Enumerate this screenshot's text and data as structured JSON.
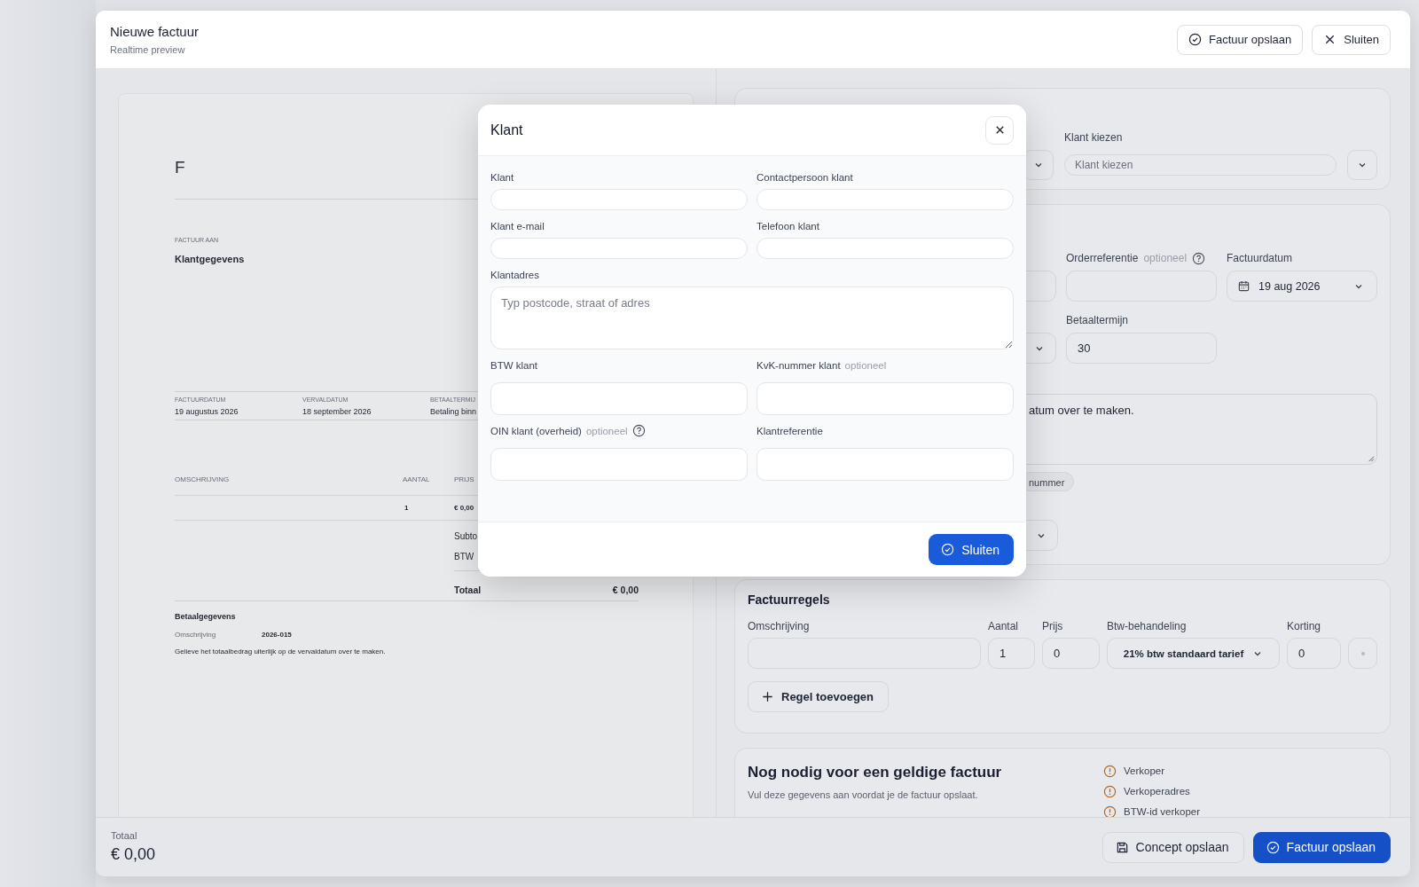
{
  "window": {
    "title": "Nieuwe factuur",
    "subtitle": "Realtime preview"
  },
  "header_buttons": [
    {
      "label": "Factuur opslaan",
      "kind": "save"
    },
    {
      "label": "Sluiten",
      "kind": "close"
    }
  ],
  "preview": {
    "logo": "F",
    "bill_to_label": "FACTUUR AAN",
    "bill_to": "Klantgegevens",
    "meta": [
      {
        "label": "FACTUURDATUM",
        "value": "19 augustus 2026"
      },
      {
        "label": "VERVALDATUM",
        "value": "18 september 2026"
      },
      {
        "label": "BETAALTERMIJ",
        "value": "Betaling binn"
      }
    ],
    "columns": [
      "OMSCHRIJVING",
      "AANTAL",
      "PRIJS"
    ],
    "rows": [
      {
        "quantity": "1",
        "price": "€ 0,00"
      }
    ],
    "totals": [
      {
        "label": "Subto",
        "kind": "sub"
      },
      {
        "label": "BTW",
        "kind": "sub"
      },
      {
        "label": "Totaal",
        "value": "€ 0,00",
        "kind": "total"
      }
    ],
    "payment": {
      "title": "Betaalgegevens",
      "rows": [
        {
          "label": "Omschrijving",
          "value": "2026-015"
        }
      ],
      "note": "Gelieve het totaalbedrag uiterlijk op de vervaldatum over te maken."
    }
  },
  "client_card": {
    "label": "Klant kiezen",
    "placeholder": "Klant kiezen"
  },
  "details_card": {
    "order_reference": {
      "label": "Orderreferentie",
      "hint": "optioneel",
      "help": true
    },
    "invoice_date": {
      "label": "Factuurdatum",
      "value": "19 aug 2026"
    },
    "payment_term": {
      "label": "Betaaltermijn",
      "value": "30"
    },
    "note_text": "atum over te maken.",
    "chip": "nummer"
  },
  "lines_card": {
    "title": "Factuurregels",
    "columns": [
      "Omschrijving",
      "Aantal",
      "Prijs",
      "Btw-behandeling",
      "Korting"
    ],
    "row": {
      "quantity": "1",
      "price": "0",
      "vat": "21% btw standaard tarief",
      "discount": "0"
    },
    "add_button": "Regel toevoegen"
  },
  "missing_card": {
    "title": "Nog nodig voor een geldige factuur",
    "subtitle": "Vul deze gegevens aan voordat je de factuur opslaat.",
    "items": [
      "Verkoper",
      "Verkoperadres",
      "BTW-id verkoper"
    ]
  },
  "footer": {
    "total_label": "Totaal",
    "total": "€ 0,00",
    "buttons": [
      {
        "label": "Concept opslaan",
        "kind": "draft"
      },
      {
        "label": "Factuur opslaan",
        "kind": "save"
      }
    ]
  },
  "modal": {
    "title": "Klant",
    "fields": [
      {
        "label": "Klant",
        "kind": "input"
      },
      {
        "label": "Contactpersoon klant",
        "kind": "input"
      },
      {
        "label": "Klant e-mail",
        "kind": "input"
      },
      {
        "label": "Telefoon klant",
        "kind": "input"
      },
      {
        "label": "Klantadres",
        "kind": "textarea",
        "placeholder": "Typ postcode, straat of adres"
      },
      {
        "label": "BTW klant",
        "kind": "input"
      },
      {
        "label": "KvK-nummer klant",
        "kind": "input",
        "hint": "optioneel"
      },
      {
        "label": "OIN klant (overheid)",
        "kind": "input",
        "hint": "optioneel",
        "help": true
      },
      {
        "label": "Klantreferentie",
        "kind": "input"
      }
    ],
    "button": "Sluiten"
  }
}
